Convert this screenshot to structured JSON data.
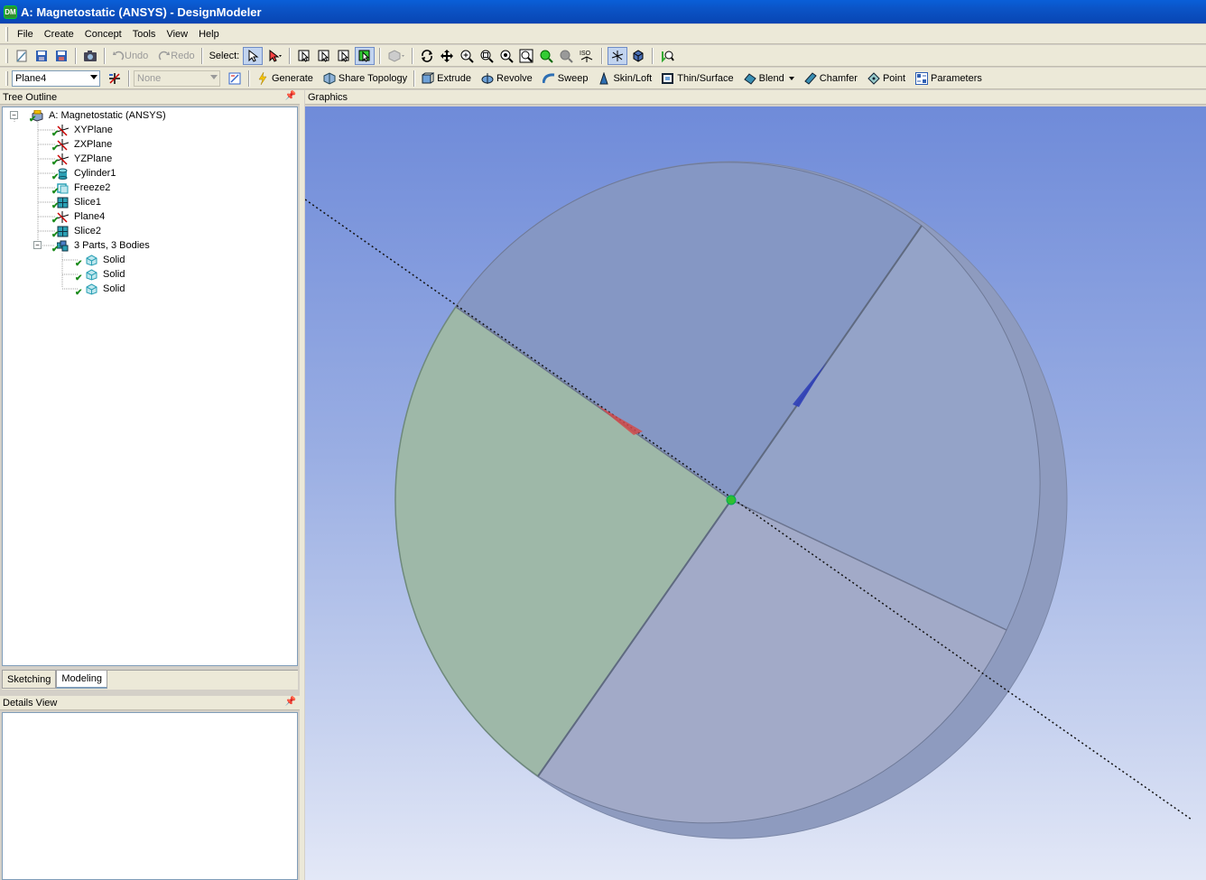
{
  "window": {
    "title": "A: Magnetostatic (ANSYS) - DesignModeler",
    "icon_label": "DM"
  },
  "menu": [
    "File",
    "Create",
    "Concept",
    "Tools",
    "View",
    "Help"
  ],
  "toolbar1": {
    "undo_label": "Undo",
    "redo_label": "Redo",
    "select_label": "Select:",
    "iso_label": "ISO"
  },
  "toolbar2": {
    "plane_value": "Plane4",
    "sketch_value": "None",
    "generate_label": "Generate",
    "share_topology_label": "Share Topology",
    "extrude_label": "Extrude",
    "revolve_label": "Revolve",
    "sweep_label": "Sweep",
    "skin_loft_label": "Skin/Loft",
    "thin_surface_label": "Thin/Surface",
    "blend_label": "Blend",
    "chamfer_label": "Chamfer",
    "point_label": "Point",
    "parameters_label": "Parameters"
  },
  "tree_outline": {
    "header": "Tree Outline",
    "root": "A: Magnetostatic (ANSYS)",
    "items": [
      "XYPlane",
      "ZXPlane",
      "YZPlane",
      "Cylinder1",
      "Freeze2",
      "Slice1",
      "Plane4",
      "Slice2",
      "3 Parts, 3 Bodies"
    ],
    "bodies": [
      "Solid",
      "Solid",
      "Solid"
    ]
  },
  "tabs": {
    "sketching": "Sketching",
    "modeling": "Modeling",
    "active": "Modeling"
  },
  "details_view": {
    "header": "Details View"
  },
  "graphics": {
    "header": "Graphics"
  },
  "colors": {
    "title_bar": "#0a5fd8",
    "toolbar_bg": "#ece9d8",
    "graphics_top": "#6f8bd9",
    "graphics_bottom": "#e3e8f7",
    "selected_body": "#9eb8a8"
  }
}
